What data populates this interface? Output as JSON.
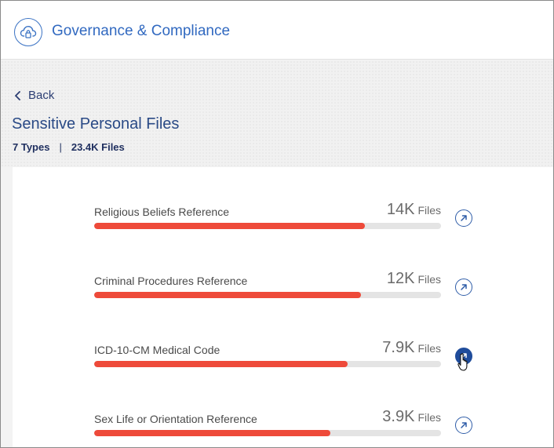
{
  "header": {
    "title": "Governance & Compliance",
    "logo_icon": "cloud-lock-icon"
  },
  "nav": {
    "back_label": "Back"
  },
  "summary": {
    "title": "Sensitive Personal Files",
    "types_label": "7 Types",
    "separator": "|",
    "files_label": "23.4K Files"
  },
  "rows": [
    {
      "label": "Religious Beliefs Reference",
      "count": "14K",
      "unit": "Files",
      "fill_fraction": 0.78
    },
    {
      "label": "Criminal Procedures Reference",
      "count": "12K",
      "unit": "Files",
      "fill_fraction": 0.77
    },
    {
      "label": "ICD-10-CM Medical Code",
      "count": "7.9K",
      "unit": "Files",
      "fill_fraction": 0.73,
      "active": true
    },
    {
      "label": "Sex Life or Orientation Reference",
      "count": "3.9K",
      "unit": "Files",
      "fill_fraction": 0.68
    }
  ],
  "colors": {
    "accent": "#3169c0",
    "bar": "#ee4a3a",
    "track": "#e4e4e4",
    "dark_navy": "#1f2f5f"
  }
}
